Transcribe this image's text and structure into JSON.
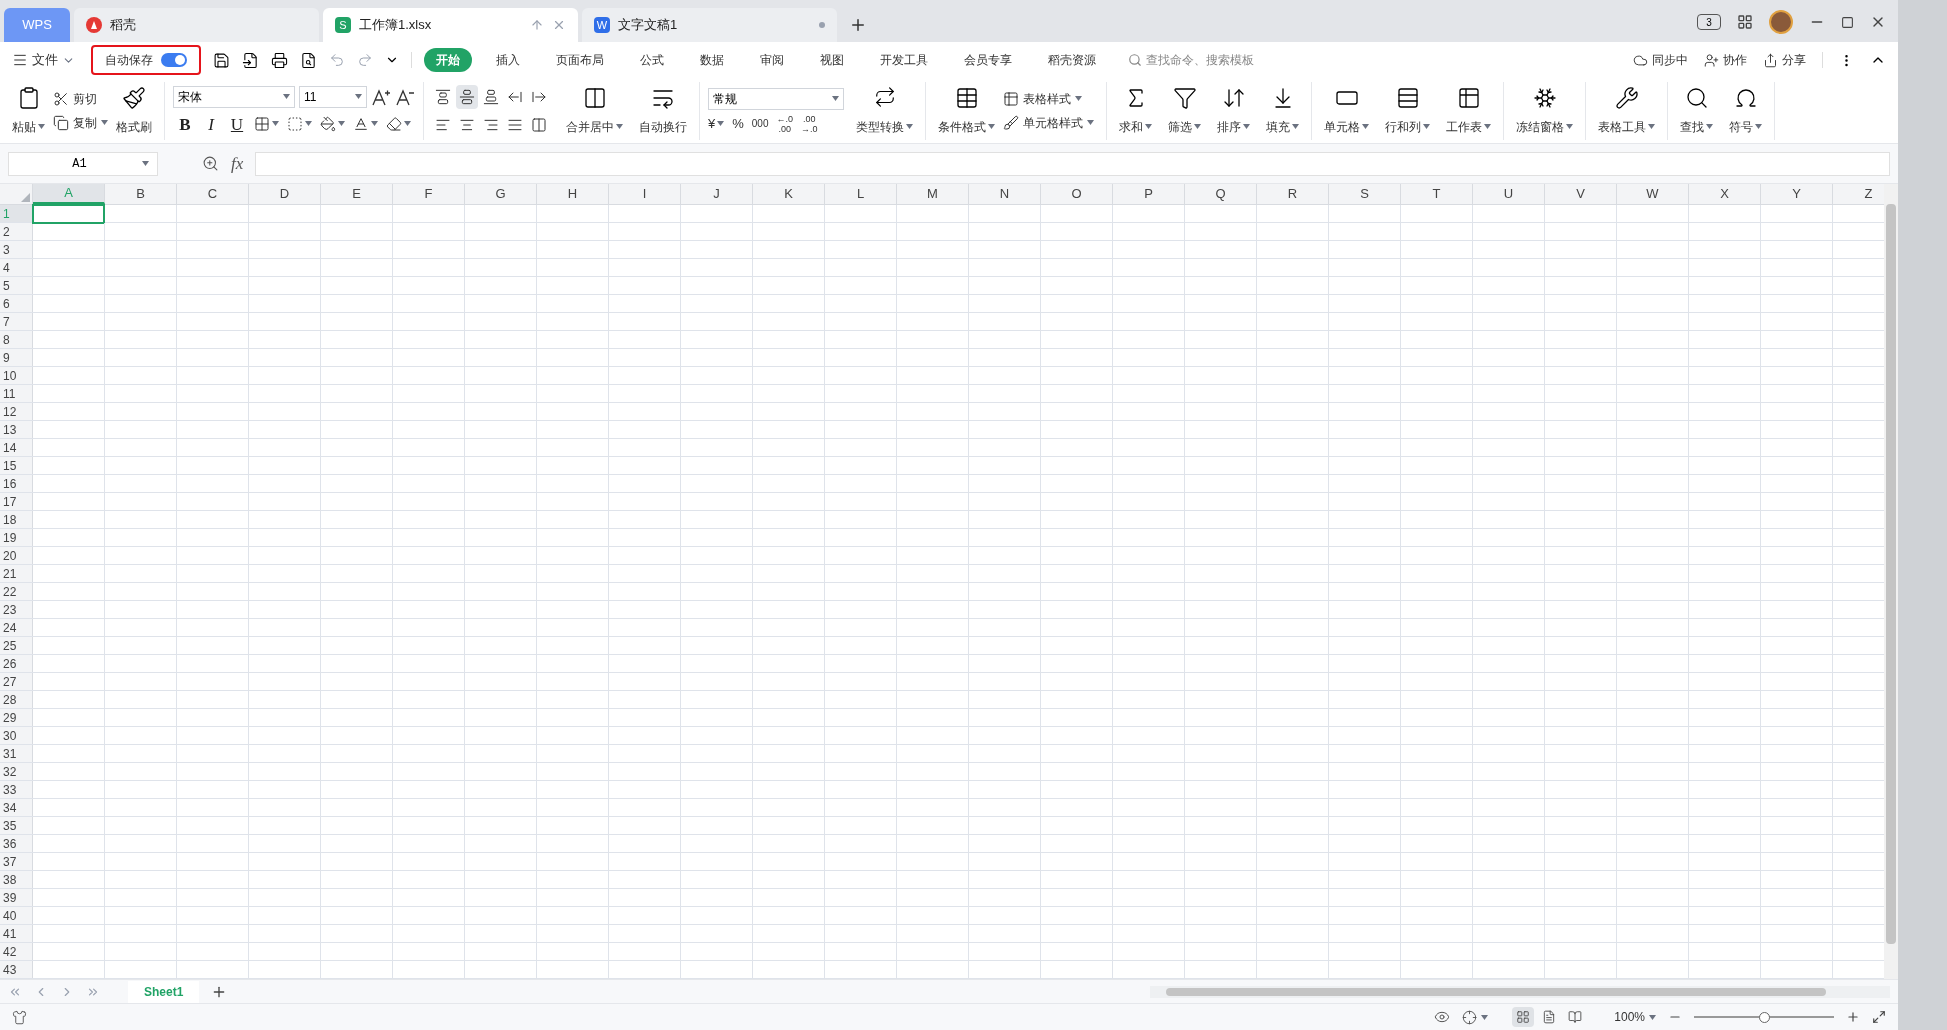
{
  "title_bar": {
    "tabs": [
      {
        "label": "WPS",
        "kind": "home",
        "selected": false
      },
      {
        "label": "稻壳",
        "kind": "docer",
        "selected": false
      },
      {
        "label": "工作簿1.xlsx",
        "kind": "sheet",
        "icon_letter": "S",
        "selected": true
      },
      {
        "label": "文字文稿1",
        "kind": "writer",
        "icon_letter": "W",
        "selected": false
      }
    ],
    "screen_count": "3"
  },
  "menu_bar": {
    "file": "文件",
    "autosave": {
      "label": "自动保存",
      "on": true,
      "highlighted": true
    },
    "tabs": [
      {
        "label": "开始",
        "selected": true
      },
      {
        "label": "插入",
        "selected": false
      },
      {
        "label": "页面布局",
        "selected": false
      },
      {
        "label": "公式",
        "selected": false
      },
      {
        "label": "数据",
        "selected": false
      },
      {
        "label": "审阅",
        "selected": false
      },
      {
        "label": "视图",
        "selected": false
      },
      {
        "label": "开发工具",
        "selected": false
      },
      {
        "label": "会员专享",
        "selected": false
      },
      {
        "label": "稻壳资源",
        "selected": false
      }
    ],
    "search": {
      "placeholder": "查找命令、搜索模板"
    },
    "actions": [
      {
        "label": "同步中",
        "kind": "cloud"
      },
      {
        "label": "协作",
        "kind": "collab"
      },
      {
        "label": "分享",
        "kind": "share"
      }
    ]
  },
  "ribbon": {
    "clipboard": {
      "paste": "粘贴",
      "cut": "剪切",
      "copy": "复制",
      "format_painter": "格式刷"
    },
    "font": {
      "name": "宋体",
      "size": "11",
      "styles": [
        {
          "label": "B",
          "kind": "bold"
        },
        {
          "label": "I",
          "kind": "italic"
        },
        {
          "label": "U",
          "kind": "underline"
        }
      ]
    },
    "alignment": {
      "merge": "合并居中",
      "wrap": "自动换行"
    },
    "number": {
      "format": "常规",
      "currency": "¥",
      "percent": "%",
      "thousands": "000",
      "decimals": [
        {
          "top": "←.0",
          "bottom": ".00"
        },
        {
          "top": ".00",
          "bottom": "→.0"
        }
      ],
      "convert": "类型转换"
    },
    "styles": {
      "conditional": "条件格式",
      "table_style": "表格样式",
      "cell_style": "单元格样式"
    },
    "tools": [
      {
        "label": "求和",
        "kind": "sum"
      },
      {
        "label": "筛选",
        "kind": "filter"
      },
      {
        "label": "排序",
        "kind": "sort"
      },
      {
        "label": "填充",
        "kind": "fill"
      },
      {
        "label": "单元格",
        "kind": "cell"
      },
      {
        "label": "行和列",
        "kind": "rowcol"
      },
      {
        "label": "工作表",
        "kind": "sheet"
      },
      {
        "label": "冻结窗格",
        "kind": "freeze"
      },
      {
        "label": "表格工具",
        "kind": "tabletools"
      },
      {
        "label": "查找",
        "kind": "find"
      },
      {
        "label": "符号",
        "kind": "symbol"
      }
    ]
  },
  "formula_bar": {
    "name_box": "A1",
    "fx": "fx"
  },
  "sheet": {
    "columns": [
      {
        "label": "A",
        "selected": true
      },
      {
        "label": "B",
        "selected": false
      },
      {
        "label": "C",
        "selected": false
      },
      {
        "label": "D",
        "selected": false
      },
      {
        "label": "E",
        "selected": false
      },
      {
        "label": "F",
        "selected": false
      },
      {
        "label": "G",
        "selected": false
      },
      {
        "label": "H",
        "selected": false
      },
      {
        "label": "I",
        "selected": false
      },
      {
        "label": "J",
        "selected": false
      },
      {
        "label": "K",
        "selected": false
      },
      {
        "label": "L",
        "selected": false
      },
      {
        "label": "M",
        "selected": false
      },
      {
        "label": "N",
        "selected": false
      },
      {
        "label": "O",
        "selected": false
      },
      {
        "label": "P",
        "selected": false
      },
      {
        "label": "Q",
        "selected": false
      },
      {
        "label": "R",
        "selected": false
      },
      {
        "label": "S",
        "selected": false
      },
      {
        "label": "T",
        "selected": false
      },
      {
        "label": "U",
        "selected": false
      },
      {
        "label": "V",
        "selected": false
      },
      {
        "label": "W",
        "selected": false
      },
      {
        "label": "X",
        "selected": false
      },
      {
        "label": "Y",
        "selected": false
      },
      {
        "label": "Z",
        "selected": false
      }
    ],
    "rows": [
      {
        "label": "1",
        "selected": true
      },
      {
        "label": "2",
        "selected": false
      },
      {
        "label": "3",
        "selected": false
      },
      {
        "label": "4",
        "selected": false
      },
      {
        "label": "5",
        "selected": false
      },
      {
        "label": "6",
        "selected": false
      },
      {
        "label": "7",
        "selected": false
      },
      {
        "label": "8",
        "selected": false
      },
      {
        "label": "9",
        "selected": false
      },
      {
        "label": "10",
        "selected": false
      },
      {
        "label": "11",
        "selected": false
      },
      {
        "label": "12",
        "selected": false
      },
      {
        "label": "13",
        "selected": false
      },
      {
        "label": "14",
        "selected": false
      },
      {
        "label": "15",
        "selected": false
      },
      {
        "label": "16",
        "selected": false
      },
      {
        "label": "17",
        "selected": false
      },
      {
        "label": "18",
        "selected": false
      },
      {
        "label": "19",
        "selected": false
      },
      {
        "label": "20",
        "selected": false
      },
      {
        "label": "21",
        "selected": false
      },
      {
        "label": "22",
        "selected": false
      },
      {
        "label": "23",
        "selected": false
      },
      {
        "label": "24",
        "selected": false
      },
      {
        "label": "25",
        "selected": false
      },
      {
        "label": "26",
        "selected": false
      },
      {
        "label": "27",
        "selected": false
      },
      {
        "label": "28",
        "selected": false
      },
      {
        "label": "29",
        "selected": false
      },
      {
        "label": "30",
        "selected": false
      },
      {
        "label": "31",
        "selected": false
      },
      {
        "label": "32",
        "selected": false
      },
      {
        "label": "33",
        "selected": false
      },
      {
        "label": "34",
        "selected": false
      },
      {
        "label": "35",
        "selected": false
      },
      {
        "label": "36",
        "selected": false
      },
      {
        "label": "37",
        "selected": false
      },
      {
        "label": "38",
        "selected": false
      },
      {
        "label": "39",
        "selected": false
      },
      {
        "label": "40",
        "selected": false
      },
      {
        "label": "41",
        "selected": false
      },
      {
        "label": "42",
        "selected": false
      },
      {
        "label": "43",
        "selected": false
      }
    ]
  },
  "sheet_tabs": [
    {
      "label": "Sheet1",
      "selected": true
    }
  ],
  "status_bar": {
    "views": [
      {
        "kind": "normal",
        "selected": true
      },
      {
        "kind": "page",
        "selected": false
      },
      {
        "kind": "reading",
        "selected": false
      }
    ],
    "zoom": "100%",
    "zoom_slider": {
      "level": 0.5
    }
  }
}
